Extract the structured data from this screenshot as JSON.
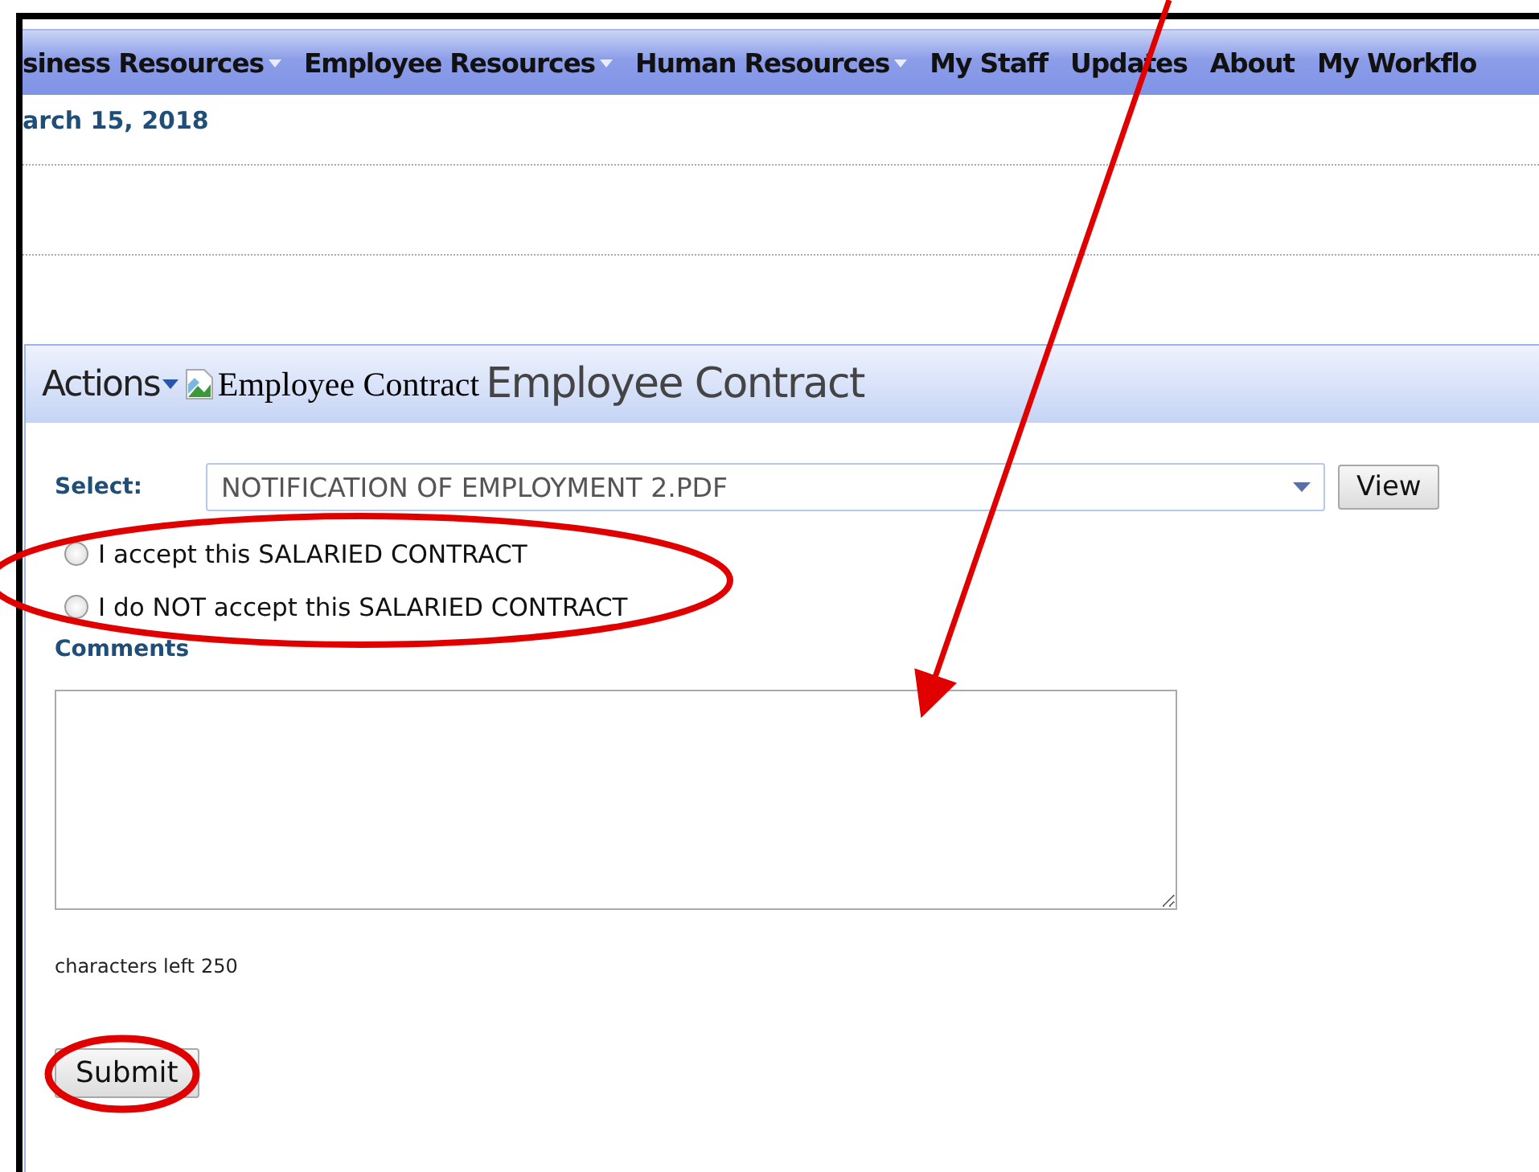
{
  "nav": {
    "items": [
      {
        "label": "siness Resources",
        "has_menu": true
      },
      {
        "label": "Employee Resources",
        "has_menu": true
      },
      {
        "label": "Human Resources",
        "has_menu": true
      },
      {
        "label": "My Staff",
        "has_menu": false
      },
      {
        "label": "Updates",
        "has_menu": false
      },
      {
        "label": "About",
        "has_menu": false
      },
      {
        "label": "My Workflo",
        "has_menu": false
      }
    ]
  },
  "date": "arch 15, 2018",
  "panel": {
    "actions": "Actions",
    "image_alt": "Employee Contract",
    "title": "Employee Contract",
    "select_label": "Select:",
    "select_value": "NOTIFICATION OF EMPLOYMENT 2.PDF",
    "view_button": "View",
    "options": [
      {
        "label": "I accept this SALARIED CONTRACT",
        "selected": false
      },
      {
        "label": "I do NOT accept this SALARIED CONTRACT",
        "selected": false
      }
    ],
    "comments_label": "Comments",
    "chars_left_label": "characters left",
    "chars_left": "250",
    "submit": "Submit"
  }
}
